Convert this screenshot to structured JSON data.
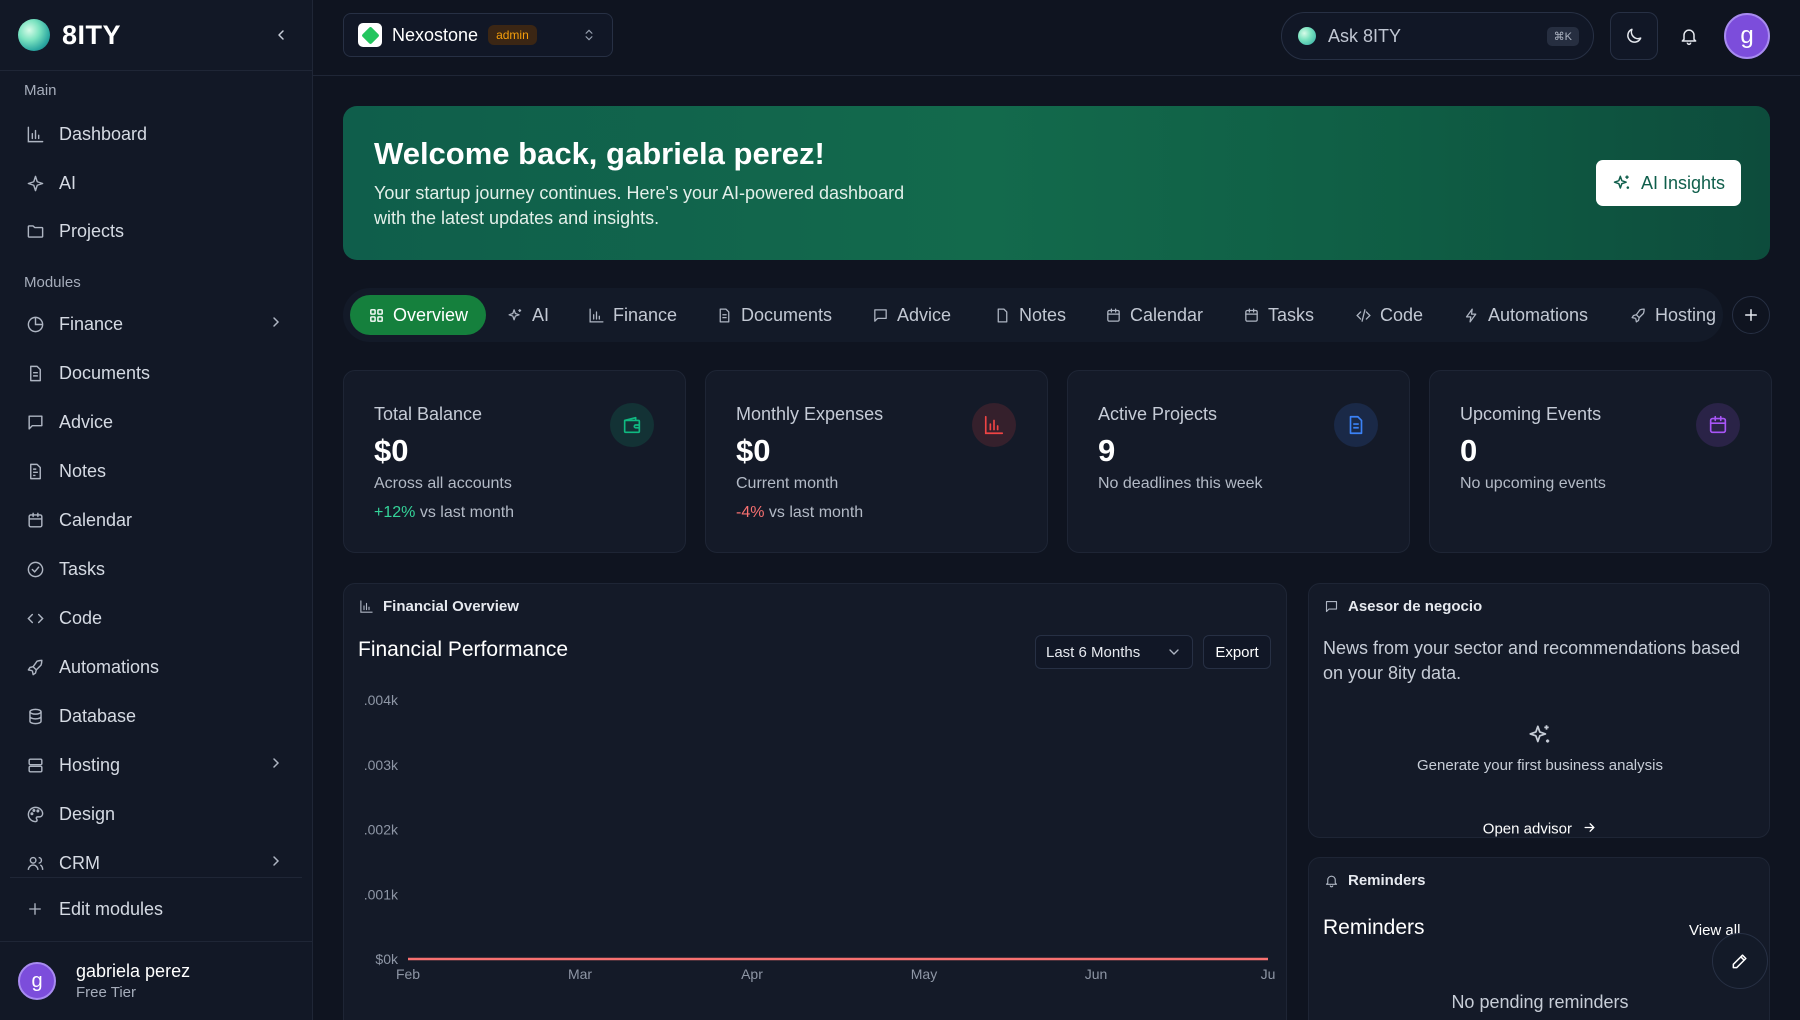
{
  "brand": {
    "name": "8ITY"
  },
  "sidebar": {
    "main_label": "Main",
    "modules_label": "Modules",
    "main_items": [
      {
        "label": "Dashboard",
        "icon": "bar-chart-icon"
      },
      {
        "label": "AI",
        "icon": "sparkle-icon"
      },
      {
        "label": "Projects",
        "icon": "folder-icon"
      }
    ],
    "module_items": [
      {
        "label": "Finance",
        "icon": "pie-chart-icon",
        "has_children": true
      },
      {
        "label": "Documents",
        "icon": "document-icon"
      },
      {
        "label": "Advice",
        "icon": "message-icon"
      },
      {
        "label": "Notes",
        "icon": "notes-icon"
      },
      {
        "label": "Calendar",
        "icon": "calendar-icon"
      },
      {
        "label": "Tasks",
        "icon": "check-circle-icon"
      },
      {
        "label": "Code",
        "icon": "code-icon"
      },
      {
        "label": "Automations",
        "icon": "rocket-icon"
      },
      {
        "label": "Database",
        "icon": "database-icon"
      },
      {
        "label": "Hosting",
        "icon": "server-icon",
        "has_children": true
      },
      {
        "label": "Design",
        "icon": "palette-icon"
      },
      {
        "label": "CRM",
        "icon": "users-icon",
        "has_children": true
      }
    ],
    "edit_modules": "Edit modules",
    "user": {
      "initial": "g",
      "name": "gabriela perez",
      "tier": "Free Tier"
    }
  },
  "topbar": {
    "workspace": {
      "name": "Nexostone",
      "badge": "admin"
    },
    "ask": {
      "label": "Ask 8ITY",
      "shortcut": "⌘K"
    },
    "avatar_initial": "g"
  },
  "banner": {
    "title": "Welcome back, gabriela perez!",
    "subtitle": "Your startup journey continues. Here's your AI-powered dashboard with the latest updates and insights.",
    "button": "AI Insights"
  },
  "tabs": [
    {
      "label": "Overview",
      "icon": "grid-icon",
      "active": true
    },
    {
      "label": "AI",
      "icon": "sparkle-icon"
    },
    {
      "label": "Finance",
      "icon": "bar-chart-icon"
    },
    {
      "label": "Documents",
      "icon": "document-icon"
    },
    {
      "label": "Advice",
      "icon": "message-icon"
    },
    {
      "label": "Notes",
      "icon": "notes-icon"
    },
    {
      "label": "Calendar",
      "icon": "calendar-icon"
    },
    {
      "label": "Tasks",
      "icon": "calendar-icon"
    },
    {
      "label": "Code",
      "icon": "code-icon"
    },
    {
      "label": "Automations",
      "icon": "bolt-icon"
    },
    {
      "label": "Hosting",
      "icon": "rocket-icon"
    }
  ],
  "stats": [
    {
      "title": "Total Balance",
      "value": "$0",
      "sub": "Across all accounts",
      "trend": "+12%",
      "trend_text": " vs last month",
      "trend_dir": "up",
      "icon": "wallet-icon",
      "color": "#10b981"
    },
    {
      "title": "Monthly Expenses",
      "value": "$0",
      "sub": "Current month",
      "trend": "-4%",
      "trend_text": " vs last month",
      "trend_dir": "down",
      "icon": "bar-chart-icon",
      "color": "#ef4444"
    },
    {
      "title": "Active Projects",
      "value": "9",
      "sub": "No deadlines this week",
      "icon": "document-icon",
      "color": "#3b82f6"
    },
    {
      "title": "Upcoming Events",
      "value": "0",
      "sub": "No upcoming events",
      "icon": "calendar-icon",
      "color": "#a855f7"
    }
  ],
  "financial": {
    "header": "Financial Overview",
    "title": "Financial Performance",
    "range": "Last 6 Months",
    "export": "Export"
  },
  "chart_data": {
    "type": "line",
    "x": [
      "Feb",
      "Mar",
      "Apr",
      "May",
      "Jun",
      "Ju"
    ],
    "y_ticks": [
      ".004k",
      ".003k",
      ".002k",
      ".001k",
      "$0k"
    ],
    "series": [
      {
        "values": [
          0,
          0,
          0,
          0,
          0,
          0
        ],
        "color": "#f87171"
      }
    ],
    "ylim": [
      0,
      0.004
    ],
    "grid": false
  },
  "advisor": {
    "header": "Asesor de negocio",
    "description": "News from your sector and recommendations based on your 8ity data.",
    "cta": "Generate your first business analysis",
    "link": "Open advisor"
  },
  "reminders": {
    "header": "Reminders",
    "title": "Reminders",
    "view_all": "View all",
    "empty": "No pending reminders"
  }
}
